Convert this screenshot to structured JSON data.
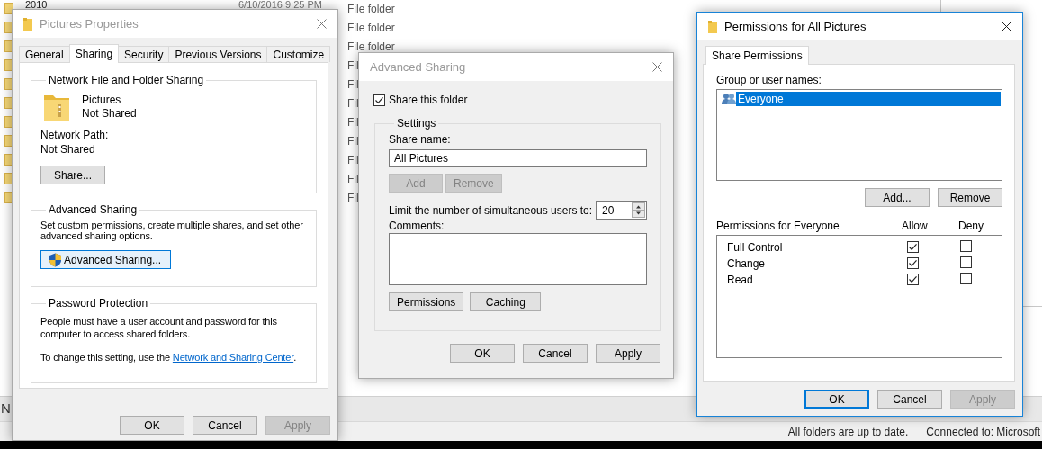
{
  "explorer": {
    "rows": [
      {
        "name": "2010",
        "date": "6/10/2016 9:25 PM",
        "type": "File folder"
      },
      {
        "type": "File folder"
      },
      {
        "type": "File folder"
      },
      {
        "type": "Fil"
      },
      {
        "type": "Fil"
      },
      {
        "type": "Fil"
      },
      {
        "type": "Fil"
      },
      {
        "type": "Fil"
      },
      {
        "type": "Fil"
      },
      {
        "type": "Fil"
      },
      {
        "type": "Fil"
      }
    ],
    "cut_text": "N",
    "status_bar": [
      "All folders are up to date.",
      "Connected to: Microsoft"
    ]
  },
  "properties": {
    "title": "Pictures Properties",
    "tabs": [
      {
        "label": "General",
        "selected": false
      },
      {
        "label": "Sharing",
        "selected": true
      },
      {
        "label": "Security",
        "selected": false
      },
      {
        "label": "Previous Versions",
        "selected": false
      },
      {
        "label": "Customize",
        "selected": false
      }
    ],
    "network_sharing": {
      "title": "Network File and Folder Sharing",
      "folder_name": "Pictures",
      "folder_status": "Not Shared",
      "path_label": "Network Path:",
      "path_value": "Not Shared",
      "share_button": "Share..."
    },
    "advanced_sharing": {
      "title": "Advanced Sharing",
      "description": "Set custom permissions, create multiple shares, and set other advanced sharing options.",
      "button": {
        "label": "Advanced Sharing...",
        "highlighted": true
      }
    },
    "password_protection": {
      "title": "Password Protection",
      "description": "People must have a user account and password for this computer to access shared folders.",
      "change_text": "To change this setting, use the ",
      "link": "Network and Sharing Center",
      "change_end": "."
    },
    "buttons": [
      {
        "label": "OK",
        "disabled": false
      },
      {
        "label": "Cancel",
        "disabled": false
      },
      {
        "label": "Apply",
        "disabled": true
      }
    ]
  },
  "advanced": {
    "title": "Advanced Sharing",
    "share_folder": {
      "label": "Share this folder",
      "checked": true
    },
    "settings": {
      "title": "Settings",
      "share_name_label": "Share name:",
      "share_name": "All Pictures",
      "name_buttons": [
        {
          "label": "Add",
          "disabled": true
        },
        {
          "label": "Remove",
          "disabled": true
        }
      ],
      "limit_label": "Limit the number of simultaneous users to:",
      "limit_value": "20",
      "comments_label": "Comments:",
      "buttons": [
        {
          "label": "Permissions",
          "disabled": false
        },
        {
          "label": "Caching",
          "disabled": false
        }
      ]
    },
    "buttons": [
      {
        "label": "OK",
        "disabled": false
      },
      {
        "label": "Cancel",
        "disabled": false
      },
      {
        "label": "Apply",
        "disabled": false
      }
    ]
  },
  "permissions": {
    "title": "Permissions for All Pictures",
    "tab": {
      "label": "Share Permissions",
      "selected": true
    },
    "group_label": "Group or user names:",
    "users": [
      {
        "name": "Everyone",
        "selected": true
      }
    ],
    "user_buttons": [
      {
        "label": "Add...",
        "disabled": false
      },
      {
        "label": "Remove",
        "disabled": false
      }
    ],
    "permissions_label": "Permissions for Everyone",
    "allow_header": "Allow",
    "deny_header": "Deny",
    "rows": [
      {
        "name": "Full Control",
        "allow": true,
        "deny": false
      },
      {
        "name": "Change",
        "allow": true,
        "deny": false
      },
      {
        "name": "Read",
        "allow": true,
        "deny": false
      }
    ],
    "buttons": [
      {
        "label": "OK",
        "disabled": false,
        "focused": true
      },
      {
        "label": "Cancel",
        "disabled": false,
        "focused": false
      },
      {
        "label": "Apply",
        "disabled": true,
        "focused": false
      }
    ]
  }
}
